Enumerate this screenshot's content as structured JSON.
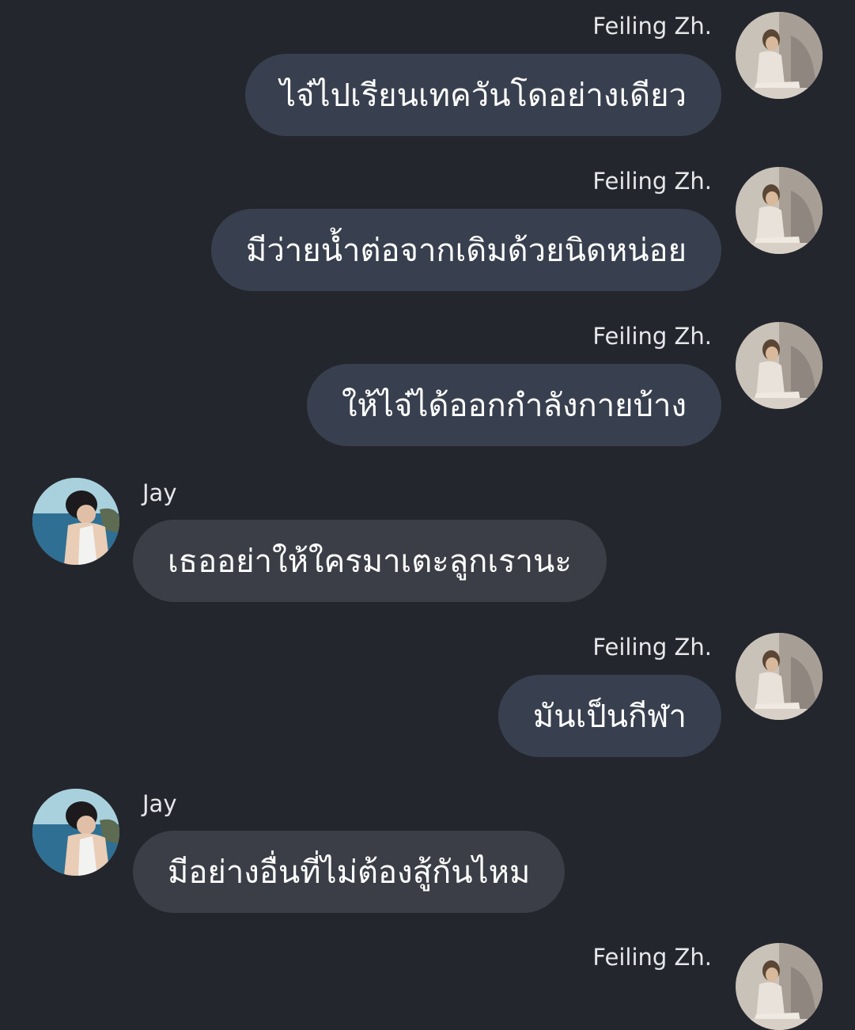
{
  "messages": [
    {
      "sender": "Feiling Zh.",
      "text": "ไจ๋ไปเรียนเทควันโดอย่างเดียว",
      "side": "right"
    },
    {
      "sender": "Feiling Zh.",
      "text": "มีว่ายน้ำต่อจากเดิมด้วยนิดหน่อย",
      "side": "right"
    },
    {
      "sender": "Feiling Zh.",
      "text": "ให้ไจ๋ได้ออกกำลังกายบ้าง",
      "side": "right"
    },
    {
      "sender": "Jay",
      "text": "เธออย่าให้ใครมาเตะลูกเรานะ",
      "side": "left"
    },
    {
      "sender": "Feiling Zh.",
      "text": "มันเป็นกีฬา",
      "side": "right"
    },
    {
      "sender": "Jay",
      "text": "มีอย่างอื่นที่ไม่ต้องสู้กันไหม",
      "side": "left"
    }
  ],
  "partial": {
    "sender": "Feiling Zh."
  },
  "colors": {
    "background": "#24262d",
    "outgoing_bubble": "#38404f",
    "incoming_bubble": "#3b3e46",
    "text": "#ffffff"
  },
  "icons": {
    "feiling_avatar": "avatar-feiling-icon",
    "jay_avatar": "avatar-jay-icon"
  }
}
